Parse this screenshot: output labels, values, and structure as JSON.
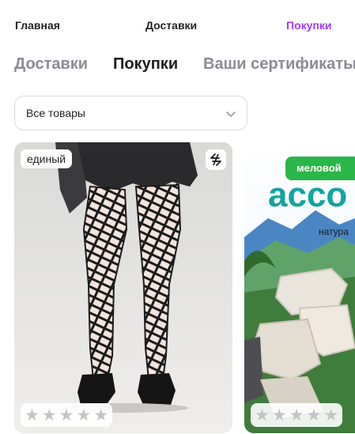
{
  "top_nav": {
    "items": [
      "Главная",
      "Доставки",
      "Покупки"
    ],
    "active_index": 2,
    "accent_color": "#a33bf6"
  },
  "tabs": {
    "items": [
      "Доставки",
      "Покупки",
      "Ваши сертификаты"
    ],
    "active_index": 1
  },
  "filter": {
    "selected": "Все товары",
    "icon": "chevron-down-icon"
  },
  "products": [
    {
      "badge": "единый",
      "action_icon": "swap-icon",
      "rating_stars": 5,
      "rating_value": 0
    },
    {
      "promo_label": "меловой",
      "promo_title": "ассо",
      "promo_subtitle": "натура",
      "rating_stars": 5,
      "rating_value": 0
    }
  ]
}
